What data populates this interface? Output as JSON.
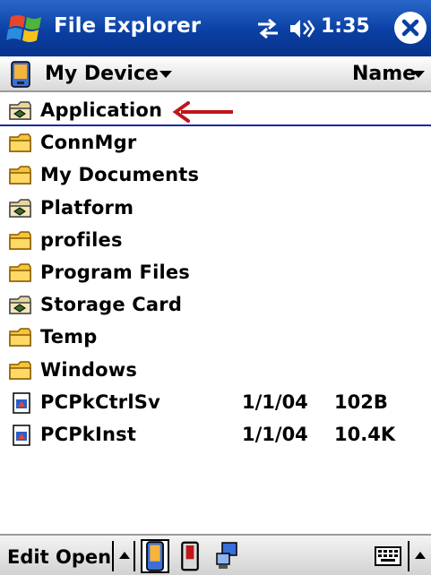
{
  "titlebar": {
    "title": "File Explorer",
    "time": "1:35"
  },
  "location": {
    "label": "My Device",
    "sort_label": "Name"
  },
  "files": [
    {
      "name": "Application",
      "icon": "shared-folder-icon",
      "date": "",
      "size": "",
      "selected": true
    },
    {
      "name": "ConnMgr",
      "icon": "folder-icon",
      "date": "",
      "size": ""
    },
    {
      "name": "My Documents",
      "icon": "folder-icon",
      "date": "",
      "size": ""
    },
    {
      "name": "Platform",
      "icon": "shared-folder-icon",
      "date": "",
      "size": ""
    },
    {
      "name": "profiles",
      "icon": "folder-icon",
      "date": "",
      "size": ""
    },
    {
      "name": "Program Files",
      "icon": "folder-icon",
      "date": "",
      "size": ""
    },
    {
      "name": "Storage Card",
      "icon": "shared-folder-icon",
      "date": "",
      "size": ""
    },
    {
      "name": "Temp",
      "icon": "folder-icon",
      "date": "",
      "size": ""
    },
    {
      "name": "Windows",
      "icon": "folder-icon",
      "date": "",
      "size": ""
    },
    {
      "name": "PCPkCtrlSv",
      "icon": "program-file-icon",
      "date": "1/1/04",
      "size": "102B"
    },
    {
      "name": "PCPkInst",
      "icon": "program-file-icon",
      "date": "1/1/04",
      "size": "10.4K"
    }
  ],
  "menubar": {
    "edit_label": "Edit",
    "open_label": "Open"
  },
  "colors": {
    "titlebar": "#0a3fa3",
    "arrow": "#c0151c",
    "folder": "#f5c43a"
  }
}
